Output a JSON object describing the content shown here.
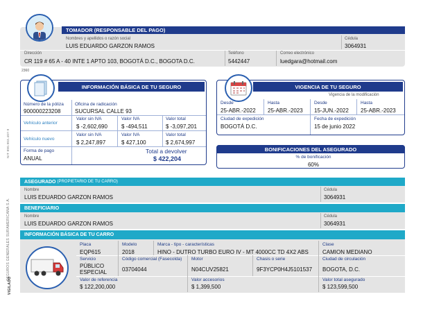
{
  "tomador": {
    "header": "TOMADOR (RESPONSABLE DEL PAGO)",
    "nombre_label": "Nombres y apellidos o razón social",
    "nombre": "LUIS EDUARDO GARZON RAMOS",
    "cedula_label": "Cédula",
    "cedula": "3064931",
    "direccion_label": "Dirección",
    "direccion": "CR 119 # 65 A - 40 INTE 1 APTO 103, BOGOTÁ D.C., BOGOTA D.C.",
    "telefono_label": "Teléfono",
    "telefono": "5442447",
    "correo_label": "Correo electrónico",
    "correo": "luedgara@hotmail.com"
  },
  "info_basica": {
    "header": "INFORMACIÓN BÁSICA DE TU SEGURO",
    "poliza_label": "Número de la póliza",
    "poliza": "900000223208",
    "oficina_label": "Oficina de radicación",
    "oficina": "SUCURSAL CALLE 93",
    "col_sin_iva": "Valor sin IVA",
    "col_iva": "Valor IVA",
    "col_total": "Valor total",
    "anterior_label": "Vehículo anterior",
    "anterior_sin_iva": "$ -2,602,690",
    "anterior_iva": "$ -494,511",
    "anterior_total": "$ -3,097,201",
    "nuevo_label": "Vehículo nuevo",
    "nuevo_sin_iva": "$ 2,247,897",
    "nuevo_iva": "$ 427,100",
    "nuevo_total": "$ 2,674,997",
    "forma_pago_label": "Forma de pago",
    "forma_pago": "ANUAL",
    "total_devolver_label": "Total a devolver",
    "total_devolver": "$ 422,204"
  },
  "vigencia": {
    "header": "VIGENCIA DE TU SEGURO",
    "modificacion_label": "Vigencia de la modificación",
    "desde_label": "Desde",
    "desde": "25-ABR.-2022",
    "hasta_label": "Hasta",
    "hasta": "25-ABR.-2023",
    "mod_desde_label": "Desde",
    "mod_desde": "15-JUN.-2022",
    "mod_hasta_label": "Hasta",
    "mod_hasta": "25-ABR.-2023",
    "ciudad_label": "Ciudad de expedición",
    "ciudad": "BOGOTÁ D.C.",
    "fecha_label": "Fecha de expedición",
    "fecha": "15 de junio 2022"
  },
  "bonificaciones": {
    "header": "BONIFICACIONES DEL ASEGURADO",
    "pct_label": "% de bonificación",
    "pct": "60%"
  },
  "asegurado": {
    "header": "ASEGURADO",
    "header_sub": "(PROPIETARIO DE TU CARRO)",
    "nombre_label": "Nombre",
    "nombre": "LUIS EDUARDO GARZON RAMOS",
    "cedula_label": "Cédula",
    "cedula": "3064931"
  },
  "beneficiario": {
    "header": "BENEFICIARIO",
    "nombre_label": "Nombre",
    "nombre": "LUIS EDUARDO GARZON RAMOS",
    "cedula_label": "Cédula",
    "cedula": "3064931"
  },
  "carro": {
    "header": "INFORMACIÓN BÁSICA DE TU CARRO",
    "placa_label": "Placa",
    "placa": "EQP615",
    "modelo_label": "Modelo",
    "modelo": "2018",
    "marca_label": "Marca - tipo - características",
    "marca": "HINO - DUTRO TURBO EURO IV - MT 4000CC TD 4X2 ABS",
    "clase_label": "Clase",
    "clase": "CAMION MEDIANO",
    "servicio_label": "Servicio",
    "servicio_1": "PÚBLICO",
    "servicio_2": "ESPECIAL",
    "codigo_label": "Código comercial (Fasecolda)",
    "codigo": "03704044",
    "motor_label": "Motor",
    "motor": "N04CUV25821",
    "chasis_label": "Chasis o serie",
    "chasis": "9F3YCP0H4J5101537",
    "ciudad_label": "Ciudad de circulación",
    "ciudad": "BOGOTA, D.C.",
    "valor_ref_label": "Valor de referencia",
    "valor_ref": "$ 122,200,000",
    "accesorios_label": "Valor accesorios",
    "accesorios": "$ 1,399,500",
    "total_label": "Valor total asegurado",
    "total": "$ 123,599,500"
  },
  "side": {
    "company": "SEGUROS GENERALES SURAMERICANA S.A.",
    "nit": "NIT 890.903.407-9",
    "code": "2360",
    "stamp": "VIGILADO"
  },
  "colors": {
    "navy": "#1f3b8c",
    "teal": "#1fa9c8",
    "grey": "#e4e4e4",
    "total_blue": "#1f3b8c"
  }
}
